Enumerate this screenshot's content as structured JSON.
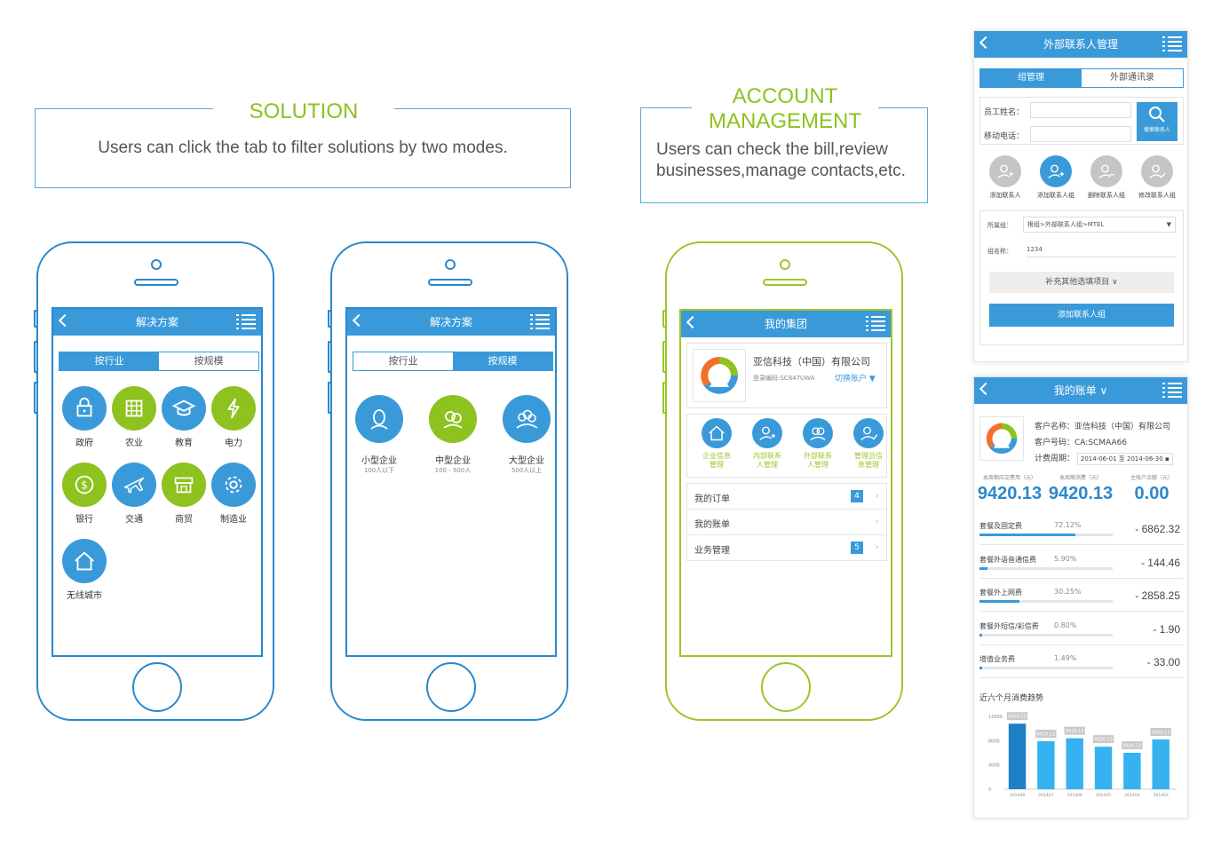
{
  "captions": {
    "solution": {
      "title": "SOLUTION",
      "text": "Users can click the tab to filter solutions by two modes."
    },
    "account": {
      "title_line1": "ACCOUNT",
      "title_line2": "MANAGEMENT",
      "text_line1": "Users can check the bill,review",
      "text_line2": "businesses,manage contacts,etc."
    }
  },
  "colors": {
    "blue": "#3a9ad9",
    "green": "#8dc21f",
    "phone_blue": "#2a88cc",
    "phone_green": "#9cc629"
  },
  "phone1": {
    "title": "解决方案",
    "tab_industry": "按行业",
    "tab_scale": "按规模",
    "items": [
      {
        "label": "政府",
        "icon": "lock-icon"
      },
      {
        "label": "农业",
        "icon": "grid-icon"
      },
      {
        "label": "教育",
        "icon": "graduation-cap-icon"
      },
      {
        "label": "电力",
        "icon": "lightning-icon"
      },
      {
        "label": "银行",
        "icon": "dollar-icon"
      },
      {
        "label": "交通",
        "icon": "airplane-icon"
      },
      {
        "label": "商贸",
        "icon": "storefront-icon"
      },
      {
        "label": "制造业",
        "icon": "gear-icon"
      },
      {
        "label": "无线城市",
        "icon": "house-icon"
      }
    ]
  },
  "phone2": {
    "title": "解决方案",
    "tab_industry": "按行业",
    "tab_scale": "按规模",
    "items": [
      {
        "label": "小型企业",
        "sub": "100人以下",
        "icon": "single-user-icon"
      },
      {
        "label": "中型企业",
        "sub": "100 - 500人",
        "icon": "two-users-icon"
      },
      {
        "label": "大型企业",
        "sub": "500人以上",
        "icon": "group-users-icon"
      }
    ]
  },
  "phone3": {
    "title": "我的集团",
    "company": "亚信科技（中国）有限公司",
    "login_code": "登录编码:SC847UWA",
    "switch": "切换账户 ▼",
    "actions": [
      {
        "line1": "企业信息",
        "line2": "管理",
        "icon": "home-icon"
      },
      {
        "line1": "内部联系",
        "line2": "人管理",
        "icon": "add-user-icon"
      },
      {
        "line1": "外部联系",
        "line2": "人管理",
        "icon": "users-icon"
      },
      {
        "line1": "管理员信",
        "line2": "息管理",
        "icon": "user-check-icon"
      }
    ],
    "list": [
      {
        "label": "我的订单",
        "badge": "4"
      },
      {
        "label": "我的账单",
        "badge": ""
      },
      {
        "label": "业务管理",
        "badge": "5"
      }
    ]
  },
  "contacts": {
    "title": "外部联系人管理",
    "tab_group": "组管理",
    "tab_book": "外部通讯录",
    "name_label": "员工姓名：",
    "phone_label": "移动电话：",
    "search": "搜索联系人",
    "actions": [
      "添加联系人",
      "添加联系人组",
      "删除联系人组",
      "修改联系人组"
    ],
    "group_label": "所属组：",
    "group_value": "根组>外部联系人组>MTEL",
    "groupname_label": "组名称：",
    "groupname_value": "1234",
    "more": "补充其他选填项目 ∨",
    "submit": "添加联系人组"
  },
  "bill": {
    "title": "我的账单 ∨",
    "customer_label": "客户名称：",
    "customer": "亚信科技（中国）有限公司",
    "code_label": "客户号码：",
    "code": "CA:SCMAA66",
    "period_label": "计费周期：",
    "period": "2014-06-01 至 2014-06-30",
    "stats": [
      {
        "label": "本周期应交费用（元）",
        "value": "9420.13"
      },
      {
        "label": "本周期消费（元）",
        "value": "9420.13"
      },
      {
        "label": "主账户余额（元）",
        "value": "0.00"
      }
    ],
    "items": [
      {
        "name": "套餐及固定费",
        "pct": "72.12%",
        "fill": 0.7212,
        "amount": "- 6862.32"
      },
      {
        "name": "套餐外语音通信费",
        "pct": "5.90%",
        "fill": 0.059,
        "amount": "- 144.46"
      },
      {
        "name": "套餐外上网费",
        "pct": "30.25%",
        "fill": 0.3025,
        "amount": "- 2858.25"
      },
      {
        "name": "套餐外短信/彩信费",
        "pct": "0.80%",
        "fill": 0.008,
        "amount": "- 1.90"
      },
      {
        "name": "增值业务费",
        "pct": "1.49%",
        "fill": 0.0149,
        "amount": "- 33.00"
      }
    ],
    "trend_title": "近六个月消费趋势",
    "chart_data": {
      "type": "bar",
      "categories": [
        "201408",
        "201407",
        "201406",
        "201405",
        "201404",
        "201403"
      ],
      "values": [
        10800,
        7900,
        8400,
        7000,
        6000,
        8200
      ],
      "labels": [
        "9420.13",
        "9420.13",
        "9420.13",
        "9420.13",
        "9420.13",
        "9420.13"
      ],
      "yticks": [
        "12000",
        "8000",
        "4000",
        "0"
      ],
      "ylim": [
        0,
        12000
      ]
    }
  }
}
